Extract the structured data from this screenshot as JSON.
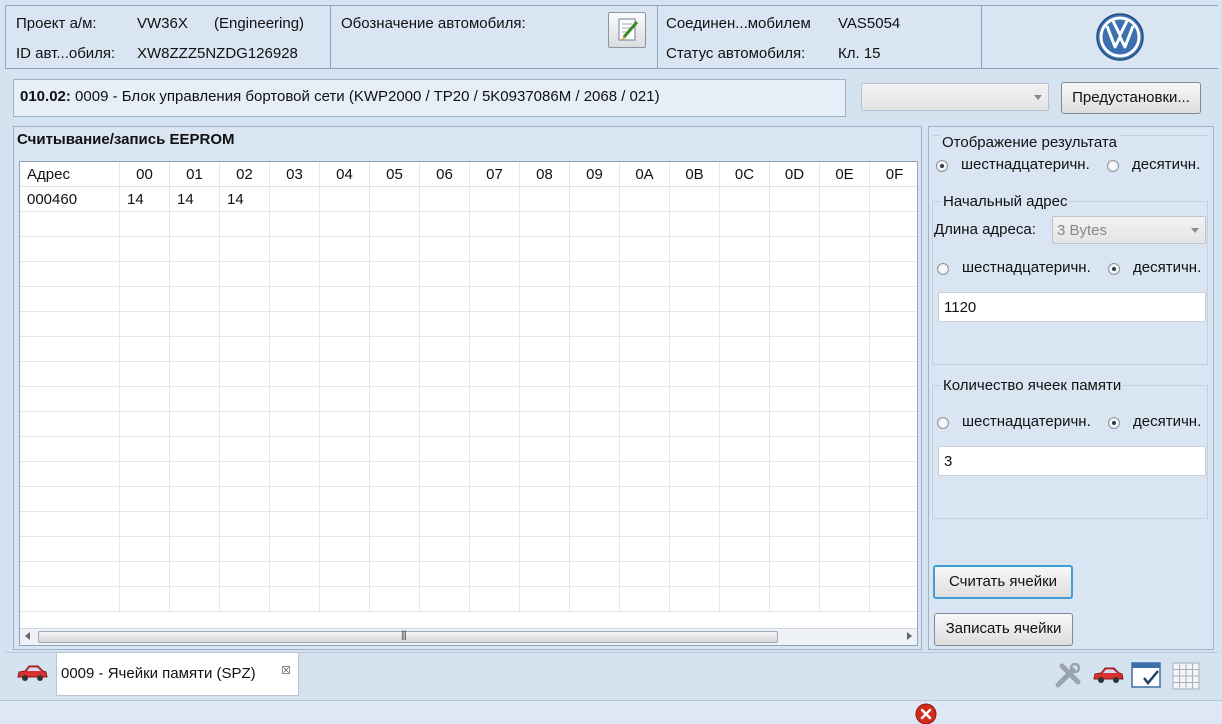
{
  "header": {
    "project_label": "Проект а/м:",
    "project_value": "VW36X",
    "project_mode": "(Engineering)",
    "vin_label": "ID авт...обиля:",
    "vin_value": "XW8ZZZ5NZDG126928",
    "vehicle_designation_label": "Обозначение автомобиля:",
    "connection_label": "Соединен...мобилем",
    "connection_value": "VAS5054",
    "status_label": "Статус автомобиля:",
    "status_value": "Кл. 15"
  },
  "control_unit": {
    "code": "010.02:",
    "description": " 0009 - Блок управления бортовой сети  (KWP2000 / TP20 / 5K0937086M  / 2068 / 021)",
    "presets_button": "Предустановки..."
  },
  "eeprom": {
    "title": "Считывание/запись EEPROM",
    "columns": [
      "Адрес",
      "00",
      "01",
      "02",
      "03",
      "04",
      "05",
      "06",
      "07",
      "08",
      "09",
      "0A",
      "0B",
      "0C",
      "0D",
      "0E",
      "0F"
    ],
    "rows": [
      [
        "000460",
        "14",
        "14",
        "14",
        "",
        "",
        "",
        "",
        "",
        "",
        "",
        "",
        "",
        "",
        "",
        "",
        ""
      ]
    ]
  },
  "right_panel": {
    "display_group": {
      "title": "Отображение результата",
      "hex_label": "шестнадцатеричн.",
      "dec_label": "десятичн.",
      "selected": "hex"
    },
    "start_address_group": {
      "title": "Начальный адрес",
      "length_label": "Длина адреса:",
      "length_value": "3 Bytes",
      "hex_label": "шестнадцатеричн.",
      "dec_label": "десятичн.",
      "selected": "dec",
      "value": "1120"
    },
    "cell_count_group": {
      "title": "Количество ячеек памяти",
      "hex_label": "шестнадцатеричн.",
      "dec_label": "десятичн.",
      "selected": "dec",
      "value": "3"
    },
    "read_button": "Считать ячейки",
    "write_button": "Записать ячейки"
  },
  "tabs": {
    "active_label": "0009 - Ячейки памяти (SPZ)",
    "close_glyph": "☒"
  }
}
